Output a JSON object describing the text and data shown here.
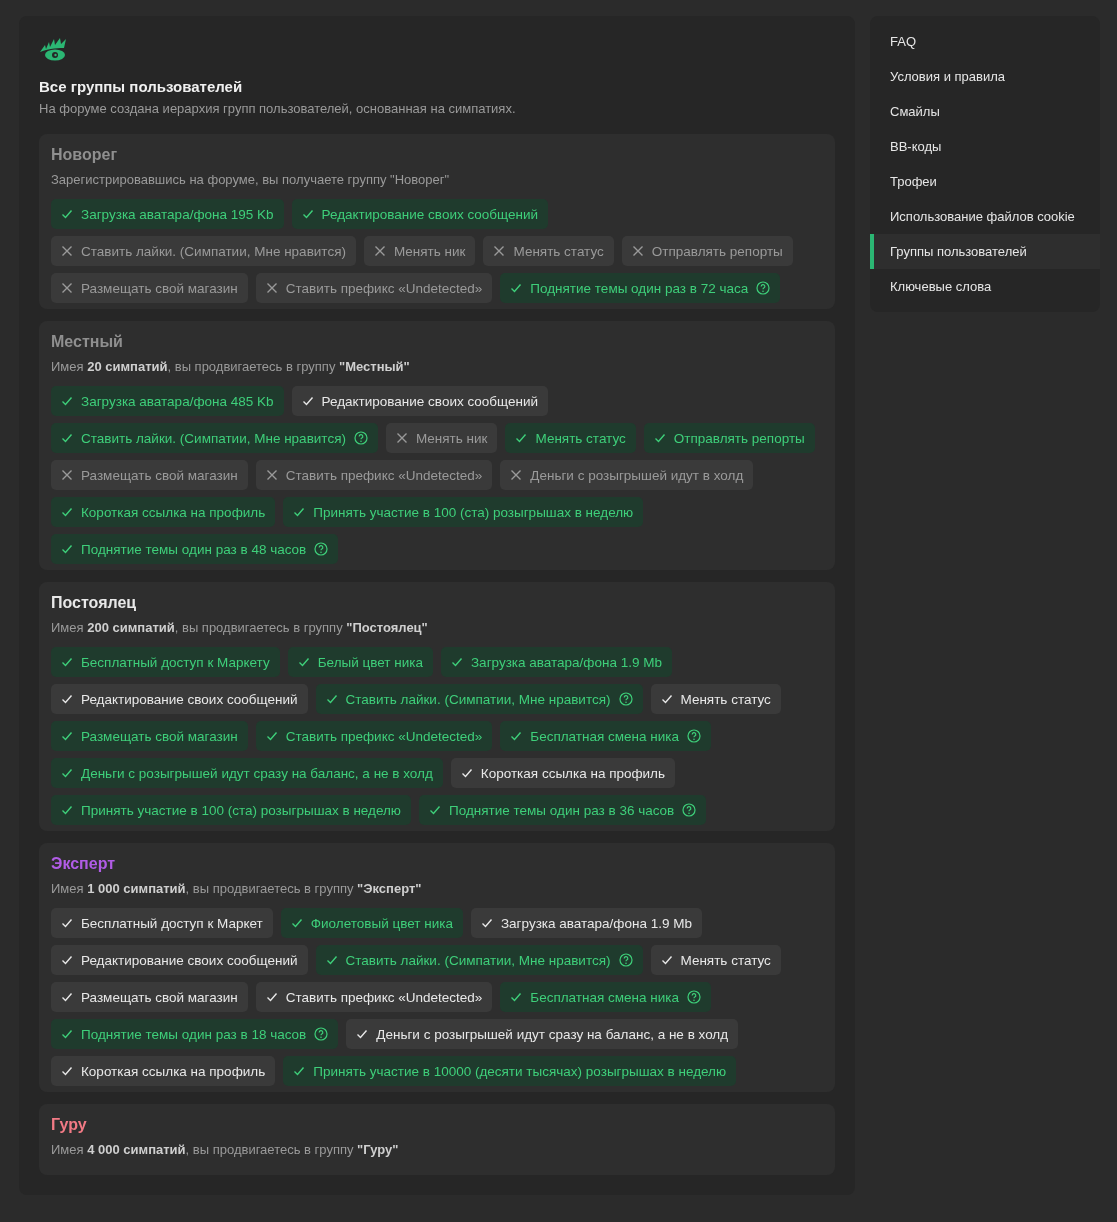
{
  "header": {
    "title": "Все группы пользователей",
    "subtitle": "На форуме создана иерархия групп пользователей, основанная на симпатиях."
  },
  "groups": [
    {
      "name": "Новорег",
      "color": "#8f8f8f",
      "description": "Зарегистрировавшись на форуме, вы получаете группу \"Новорег\"",
      "perks": [
        {
          "label": "Загрузка аватара/фона 195 Kb",
          "kind": "granted",
          "help": false
        },
        {
          "label": "Редактирование своих сообщений",
          "kind": "granted",
          "help": false
        },
        {
          "label": "Ставить лайки. (Симпатии, Мне нравится)",
          "kind": "denied",
          "help": false
        },
        {
          "label": "Менять ник",
          "kind": "denied",
          "help": false
        },
        {
          "label": "Менять статус",
          "kind": "denied",
          "help": false
        },
        {
          "label": "Отправлять репорты",
          "kind": "denied",
          "help": false
        },
        {
          "label": "Размещать свой магазин",
          "kind": "denied",
          "help": false
        },
        {
          "label": "Ставить префикс «Undetected»",
          "kind": "denied",
          "help": false
        },
        {
          "label": "Поднятие темы один раз в 72 часа",
          "kind": "granted",
          "help": true
        }
      ]
    },
    {
      "name": "Местный",
      "color": "#8f8f8f",
      "description": "Имея **20 симпатий**, вы продвигаетесь в группу **\"Местный\"**",
      "perks": [
        {
          "label": "Загрузка аватара/фона 485 Kb",
          "kind": "granted",
          "help": false
        },
        {
          "label": "Редактирование своих сообщений",
          "kind": "kept",
          "help": false
        },
        {
          "label": "Ставить лайки. (Симпатии, Мне нравится)",
          "kind": "granted",
          "help": true
        },
        {
          "label": "Менять ник",
          "kind": "denied",
          "help": false
        },
        {
          "label": "Менять статус",
          "kind": "granted",
          "help": false
        },
        {
          "label": "Отправлять репорты",
          "kind": "granted",
          "help": false
        },
        {
          "label": "Размещать свой магазин",
          "kind": "denied",
          "help": false
        },
        {
          "label": "Ставить префикс «Undetected»",
          "kind": "denied",
          "help": false
        },
        {
          "label": "Деньги с розыгрышей идут в холд",
          "kind": "denied",
          "help": false
        },
        {
          "label": "Короткая ссылка на профиль",
          "kind": "granted",
          "help": false
        },
        {
          "label": "Принять участие в 100 (ста) розыгрышах в неделю",
          "kind": "granted",
          "help": false
        },
        {
          "label": "Поднятие темы один раз в 48 часов",
          "kind": "granted",
          "help": true
        }
      ]
    },
    {
      "name": "Постоялец",
      "color": "#e8e8e8",
      "description": "Имея **200 симпатий**, вы продвигаетесь в группу **\"Постоялец\"**",
      "perks": [
        {
          "label": "Бесплатный доступ к Маркету",
          "kind": "granted",
          "help": false
        },
        {
          "label": "Белый цвет ника",
          "kind": "granted",
          "help": false
        },
        {
          "label": "Загрузка аватара/фона 1.9 Mb",
          "kind": "granted",
          "help": false
        },
        {
          "label": "Редактирование своих сообщений",
          "kind": "kept",
          "help": false
        },
        {
          "label": "Ставить лайки. (Симпатии, Мне нравится)",
          "kind": "granted",
          "help": true
        },
        {
          "label": "Менять статус",
          "kind": "kept",
          "help": false
        },
        {
          "label": "Размещать свой магазин",
          "kind": "granted",
          "help": false
        },
        {
          "label": "Ставить префикс «Undetected»",
          "kind": "granted",
          "help": false
        },
        {
          "label": "Бесплатная смена ника",
          "kind": "granted",
          "help": true
        },
        {
          "label": "Деньги с розыгрышей идут сразу на баланс, а не в холд",
          "kind": "granted",
          "help": false
        },
        {
          "label": "Короткая ссылка на профиль",
          "kind": "kept",
          "help": false
        },
        {
          "label": "Принять участие в 100 (ста) розыгрышах в неделю",
          "kind": "granted",
          "help": false
        },
        {
          "label": "Поднятие темы один раз в 36 часов",
          "kind": "granted",
          "help": true
        }
      ]
    },
    {
      "name": "Эксперт",
      "color": "#b15ce6",
      "description": "Имея **1 000 симпатий**, вы продвигаетесь в группу **\"Эксперт\"**",
      "perks": [
        {
          "label": "Бесплатный доступ к Маркет",
          "kind": "kept",
          "help": false
        },
        {
          "label": "Фиолетовый цвет ника",
          "kind": "granted",
          "help": false
        },
        {
          "label": "Загрузка аватара/фона 1.9 Mb",
          "kind": "kept",
          "help": false
        },
        {
          "label": "Редактирование своих сообщений",
          "kind": "kept",
          "help": false
        },
        {
          "label": "Ставить лайки. (Симпатии, Мне нравится)",
          "kind": "granted",
          "help": true
        },
        {
          "label": "Менять статус",
          "kind": "kept",
          "help": false
        },
        {
          "label": "Размещать свой магазин",
          "kind": "kept",
          "help": false
        },
        {
          "label": "Ставить префикс «Undetected»",
          "kind": "kept",
          "help": false
        },
        {
          "label": "Бесплатная смена ника",
          "kind": "granted",
          "help": true
        },
        {
          "label": "Поднятие темы один раз в 18 часов",
          "kind": "granted",
          "help": true
        },
        {
          "label": "Деньги с розыгрышей идут сразу на баланс, а не в холд",
          "kind": "kept",
          "help": false
        },
        {
          "label": "Короткая ссылка на профиль",
          "kind": "kept",
          "help": false
        },
        {
          "label": "Принять участие в 10000 (десяти тысячах) розыгрышах в неделю",
          "kind": "granted",
          "help": false
        }
      ]
    },
    {
      "name": "Гуру",
      "color": "#f27a85",
      "description": "Имея **4 000 симпатий**, вы продвигаетесь в группу **\"Гуру\"**"
    }
  ],
  "sidebar": {
    "items": [
      {
        "label": "FAQ",
        "selected": false
      },
      {
        "label": "Условия и правила",
        "selected": false
      },
      {
        "label": "Смайлы",
        "selected": false
      },
      {
        "label": "BB-коды",
        "selected": false
      },
      {
        "label": "Трофеи",
        "selected": false
      },
      {
        "label": "Использование файлов cookie",
        "selected": false
      },
      {
        "label": "Группы пользователей",
        "selected": true
      },
      {
        "label": "Ключевые слова",
        "selected": false
      }
    ]
  }
}
